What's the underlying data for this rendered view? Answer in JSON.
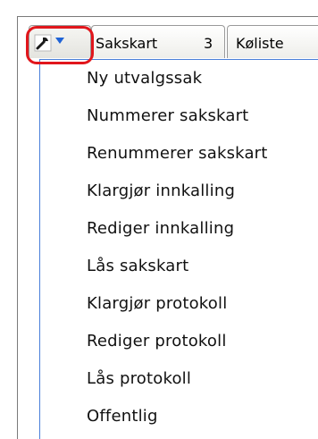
{
  "tabs": {
    "tools_tab": {
      "icon": "wrench-icon",
      "dropdown_icon": "triangle-down-icon"
    },
    "sakskart": {
      "label": "Sakskart",
      "count": "3"
    },
    "koliste": {
      "label": "Køliste"
    }
  },
  "menu": {
    "items": [
      {
        "label": "Ny utvalgssak"
      },
      {
        "label": "Nummerer sakskart"
      },
      {
        "label": "Renummerer sakskart"
      },
      {
        "label": "Klargjør innkalling"
      },
      {
        "label": "Rediger innkalling"
      },
      {
        "label": "Lås sakskart"
      },
      {
        "label": "Klargjør protokoll"
      },
      {
        "label": "Rediger protokoll"
      },
      {
        "label": "Lås protokoll"
      },
      {
        "label": "Offentlig"
      }
    ]
  },
  "colors": {
    "highlight": "#e1161c",
    "menu_border": "#4a7fd9",
    "dropdown_arrow": "#1f63d6"
  }
}
